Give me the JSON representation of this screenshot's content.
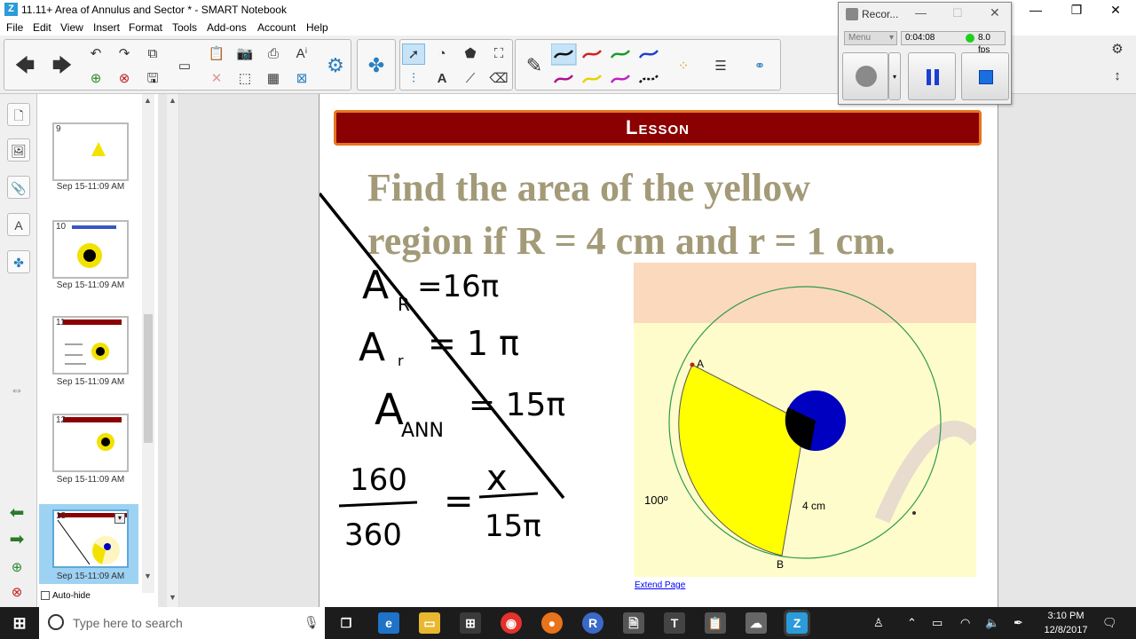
{
  "window": {
    "title": "11.11+ Area of Annulus and Sector * - SMART Notebook",
    "app_icon_glyph": "Z",
    "minimize": "—",
    "restore": "❐",
    "close": "✕"
  },
  "menu": [
    "File",
    "Edit",
    "View",
    "Insert",
    "Format",
    "Tools",
    "Add-ons",
    "Account",
    "Help"
  ],
  "pen_colors": [
    "#111111",
    "#d42020",
    "#1a9a2a",
    "#1f3fd1",
    "#b01090",
    "#e6d400",
    "#c020c0",
    "#111111"
  ],
  "sorter": {
    "slides": [
      {
        "num": "9",
        "time": "Sep 15-11:09 AM"
      },
      {
        "num": "10",
        "time": "Sep 15-11:09 AM"
      },
      {
        "num": "11",
        "time": "Sep 15-11:09 AM"
      },
      {
        "num": "12",
        "time": "Sep 15-11:09 AM"
      },
      {
        "num": "13",
        "time": "Sep 15-11:09 AM"
      }
    ],
    "autohide_label": "Auto-hide"
  },
  "slide": {
    "banner": "Lesson",
    "question_line1": "Find the area of  the yellow",
    "question_line2": "region if  R = 4 cm and r = 1 cm.",
    "figure": {
      "label_a": "A",
      "label_b": "B",
      "angle": "100º",
      "radius_label": "4 cm"
    },
    "extend_link": "Extend Page",
    "ink": {
      "line1": "A",
      "line1_sub": "R",
      "line1_val": "=16π",
      "line2": "A",
      "line2_sub": "r",
      "line2_val": "= 1 π",
      "line3": "A",
      "line3_sub": "ANN",
      "line3_val": "= 15π",
      "frac1_num": "160",
      "frac1_den": "360",
      "frac2_num": "x",
      "frac2_den": "15π",
      "eq": "="
    }
  },
  "recorder": {
    "title": "Recor...",
    "menu_label": "Menu",
    "time": "0:04:08",
    "fps": "8.0 fps"
  },
  "taskbar": {
    "search_placeholder": "Type here to search",
    "time": "3:10 PM",
    "date": "12/8/2017"
  }
}
